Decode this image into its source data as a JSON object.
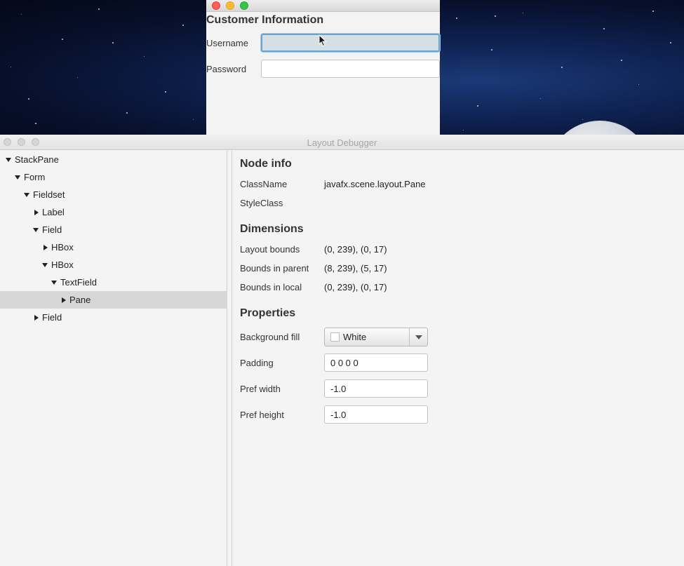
{
  "form_window": {
    "legend": "Customer Information",
    "fields": [
      {
        "label": "Username",
        "value": ""
      },
      {
        "label": "Password",
        "value": ""
      }
    ]
  },
  "debugger": {
    "title": "Layout Debugger",
    "tree": [
      {
        "label": "StackPane",
        "level": 0,
        "expanded": true
      },
      {
        "label": "Form",
        "level": 1,
        "expanded": true
      },
      {
        "label": "Fieldset",
        "level": 2,
        "expanded": true
      },
      {
        "label": "Label",
        "level": 3,
        "expanded": false
      },
      {
        "label": "Field",
        "level": 3,
        "expanded": true
      },
      {
        "label": "HBox",
        "level": 4,
        "expanded": false
      },
      {
        "label": "HBox",
        "level": 4,
        "expanded": true
      },
      {
        "label": "TextField",
        "level": 5,
        "expanded": true
      },
      {
        "label": "Pane",
        "level": 6,
        "expanded": false,
        "selected": true
      },
      {
        "label": "Field",
        "level": 3,
        "expanded": false
      }
    ],
    "node_info": {
      "heading": "Node info",
      "classname_label": "ClassName",
      "classname_value": "javafx.scene.layout.Pane",
      "styleclass_label": "StyleClass",
      "styleclass_value": ""
    },
    "dimensions": {
      "heading": "Dimensions",
      "rows": [
        {
          "label": "Layout bounds",
          "value": "(0, 239), (0, 17)"
        },
        {
          "label": "Bounds in parent",
          "value": "(8, 239), (5, 17)"
        },
        {
          "label": "Bounds in local",
          "value": "(0, 239), (0, 17)"
        }
      ]
    },
    "properties": {
      "heading": "Properties",
      "background_fill_label": "Background fill",
      "background_fill_value": "White",
      "padding_label": "Padding",
      "padding_value": "0 0 0 0",
      "pref_width_label": "Pref width",
      "pref_width_value": "-1.0",
      "pref_height_label": "Pref height",
      "pref_height_value": "-1.0"
    }
  },
  "colors": {
    "focus_ring": "#5fa6d6",
    "selected_row": "#d7d7d7",
    "close": "#fc5f57",
    "minimize": "#fdbc2e",
    "zoom": "#33c748"
  }
}
